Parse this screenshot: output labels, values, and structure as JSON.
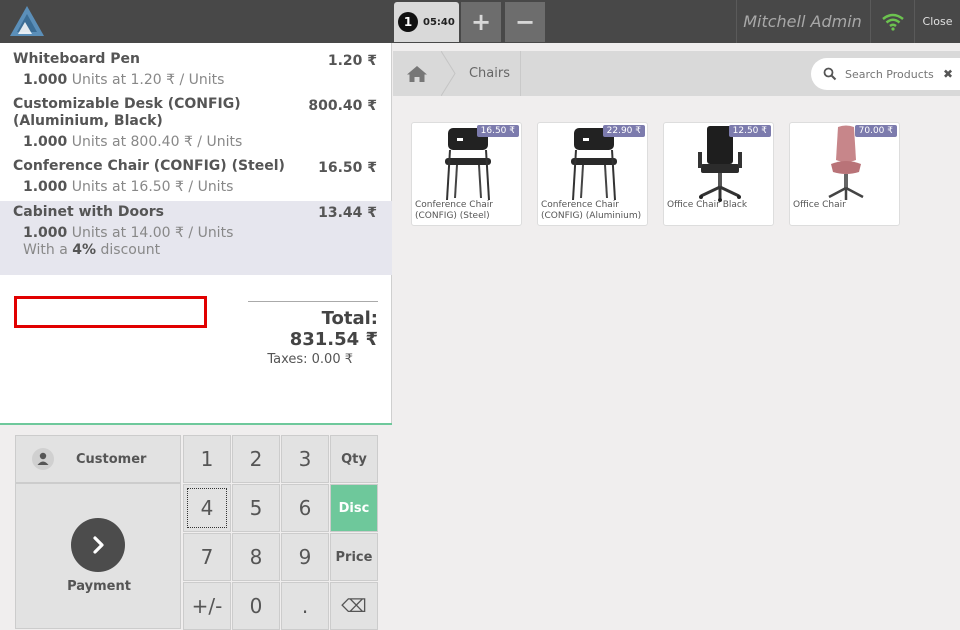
{
  "header": {
    "order_number": "1",
    "order_time": "05:40",
    "add_label": "+",
    "remove_label": "−",
    "user_name": "Mitchell Admin",
    "close_label": "Close"
  },
  "orderlines": [
    {
      "name": "Whiteboard Pen",
      "price": "1.20 ₹",
      "qty": "1.000",
      "unit_info": "Units at 1.20 ₹ / Units"
    },
    {
      "name": "Customizable Desk (CONFIG) (Aluminium, Black)",
      "price": "800.40 ₹",
      "qty": "1.000",
      "unit_info": "Units at 800.40 ₹ / Units"
    },
    {
      "name": "Conference Chair (CONFIG) (Steel)",
      "price": "16.50 ₹",
      "qty": "1.000",
      "unit_info": "Units at 16.50 ₹ / Units"
    },
    {
      "name": "Cabinet with Doors",
      "price": "13.44 ₹",
      "qty": "1.000",
      "unit_info": "Units at 14.00 ₹ / Units",
      "discount_prefix": "With a",
      "discount_value": "4%",
      "discount_suffix": "discount"
    }
  ],
  "summary": {
    "total": "Total: 831.54 ₹",
    "taxes": "Taxes: 0.00 ₹"
  },
  "controls": {
    "customer_label": "Customer",
    "payment_label": "Payment",
    "keys": [
      "1",
      "2",
      "3",
      "Qty",
      "4",
      "5",
      "6",
      "Disc",
      "7",
      "8",
      "9",
      "Price",
      "+/-",
      "0",
      ".",
      "⌫"
    ],
    "active_mode": "Disc"
  },
  "catalog": {
    "breadcrumb": "Chairs",
    "search_placeholder": "Search Products",
    "products": [
      {
        "name": "Conference Chair (CONFIG) (Steel)",
        "price": "16.50 ₹"
      },
      {
        "name": "Conference Chair (CONFIG) (Aluminium)",
        "price": "22.90 ₹"
      },
      {
        "name": "Office Chair Black",
        "price": "12.50 ₹"
      },
      {
        "name": "Office Chair",
        "price": "70.00 ₹"
      }
    ]
  },
  "colors": {
    "accent": "#6ec89b",
    "price_tag": "#7c7bad",
    "highlight": "#e10000"
  }
}
